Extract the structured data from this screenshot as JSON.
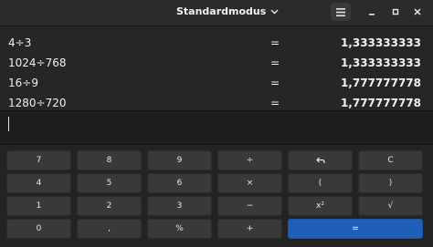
{
  "header": {
    "mode_title": "Standardmodus",
    "menu_icon": "hamburger-menu-icon",
    "minimize_icon": "minimize-icon",
    "maximize_icon": "maximize-icon",
    "close_icon": "close-icon"
  },
  "history": [
    {
      "expression": "4÷3",
      "equals": "=",
      "result": "1,333333333"
    },
    {
      "expression": "1024÷768",
      "equals": "=",
      "result": "1,333333333"
    },
    {
      "expression": "16÷9",
      "equals": "=",
      "result": "1,777777778"
    },
    {
      "expression": "1280÷720",
      "equals": "=",
      "result": "1,777777778"
    }
  ],
  "entry": {
    "value": ""
  },
  "keys": [
    [
      "7",
      "8",
      "9",
      "÷",
      "undo-icon",
      "C"
    ],
    [
      "4",
      "5",
      "6",
      "×",
      "(",
      ")"
    ],
    [
      "1",
      "2",
      "3",
      "−",
      "x²",
      "√"
    ],
    [
      "0",
      ",",
      "%",
      "+",
      "="
    ]
  ],
  "colors": {
    "background": "#1e1e1e",
    "key": "#393939",
    "equals_key": "#1f5fb8"
  }
}
